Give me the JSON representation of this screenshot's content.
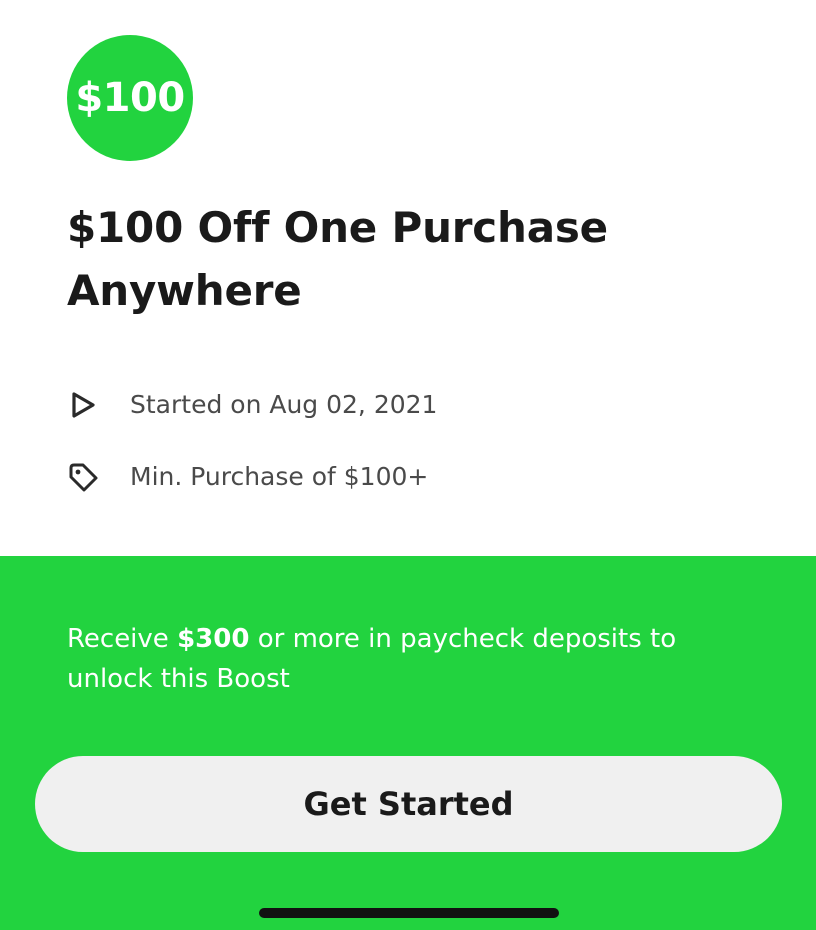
{
  "offer": {
    "badge": "$100",
    "title": "$100 Off One Purchase Anywhere",
    "started": "Started on Aug 02, 2021",
    "min_purchase": "Min. Purchase of $100+"
  },
  "unlock": {
    "prefix": "Receive ",
    "amount": "$300",
    "suffix": " or more in paycheck deposits to unlock this Boost"
  },
  "cta": {
    "label": "Get Started"
  },
  "icons": {
    "started": "play-icon",
    "min_purchase": "tag-icon"
  },
  "colors": {
    "brand_green": "#22d33f",
    "button_bg": "#f0f0f0",
    "text_dark": "#1a1a1a"
  }
}
